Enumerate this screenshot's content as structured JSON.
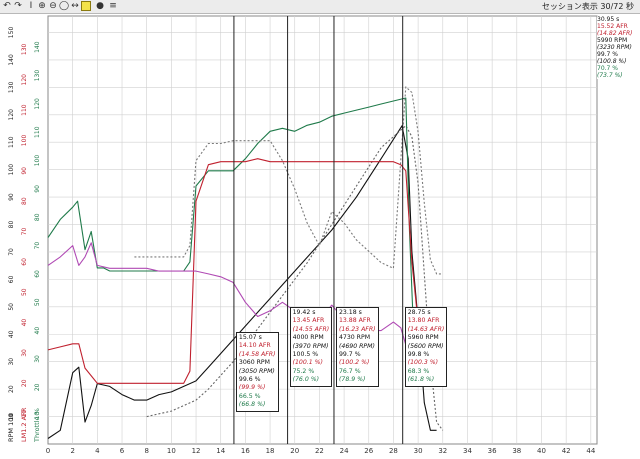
{
  "toolbar": {
    "title": "セッション表示  30/72 秒",
    "icons": [
      "undo-icon",
      "redo-icon",
      "cursor-icon",
      "zoom-in-icon",
      "zoom-out-icon",
      "zoom-fit-icon",
      "pan-icon",
      "highlight-icon",
      "record-icon",
      "menu-icon"
    ]
  },
  "info_panel": {
    "time": "30.95 s",
    "afr": "15.52 AFR",
    "afr_avg": "(14.82 AFR)",
    "rpm": "5990 RPM",
    "rpm_avg": "(3230 RPM)",
    "throttle": "99.7 %",
    "throttle_avg": "(100.8 %)",
    "throttle2": "70.7 %",
    "throttle2_avg": "(73.7 %)"
  },
  "chart_data": {
    "type": "line",
    "x_ticks": [
      "0",
      "2",
      "4",
      "6",
      "8",
      "10",
      "12",
      "14",
      "16",
      "18",
      "20",
      "22",
      "24",
      "26",
      "28",
      "30",
      "32",
      "34",
      "36",
      "38",
      "40",
      "42",
      "44"
    ],
    "xlim": [
      0,
      44.5
    ],
    "axes": {
      "rpm": {
        "ticks": [
          "10",
          "20",
          "30",
          "40",
          "50",
          "60",
          "70",
          "80",
          "90",
          "100",
          "110",
          "120",
          "130",
          "140",
          "150"
        ],
        "range": [
          0,
          156
        ],
        "label": "RPM 100",
        "color": "#222222"
      },
      "afr": {
        "ticks": [
          "10",
          "20",
          "30",
          "40",
          "50",
          "60",
          "70",
          "80",
          "90",
          "100",
          "110",
          "120",
          "130"
        ],
        "range": [
          0,
          141
        ],
        "label": "LM1.2 AFR",
        "color": "#c0202e"
      },
      "throttle": {
        "ticks": [
          "10",
          "20",
          "30",
          "40",
          "50",
          "60",
          "70",
          "80",
          "90",
          "100",
          "110",
          "120",
          "130",
          "140"
        ],
        "range": [
          0,
          151
        ],
        "label": "Throttle %",
        "color": "#1f7a4a"
      }
    },
    "cursors": [
      {
        "x": 15.07,
        "label": "15.07 s",
        "afr": "14.10 AFR",
        "afr_avg": "(14.58 AFR)",
        "rpm": "3060 RPM",
        "rpm_avg": "(3050 RPM)",
        "thr": "99.6 %",
        "thr_avg": "(99.9 %)",
        "thr2": "66.5 %",
        "thr2_avg": "(66.8 %)"
      },
      {
        "x": 19.42,
        "label": "19.42 s",
        "afr": "13.45 AFR",
        "afr_avg": "(14.55 AFR)",
        "rpm": "4000 RPM",
        "rpm_avg": "(3970 RPM)",
        "thr": "100.5 %",
        "thr_avg": "(100.1 %)",
        "thr2": "75.2 %",
        "thr2_avg": "(76.0 %)"
      },
      {
        "x": 23.18,
        "label": "23.18 s",
        "afr": "13.88 AFR",
        "afr_avg": "(16.23 AFR)",
        "rpm": "4730 RPM",
        "rpm_avg": "(4690 RPM)",
        "thr": "99.7 %",
        "thr_avg": "(100.2 %)",
        "thr2": "76.7 %",
        "thr2_avg": "(78.9 %)"
      },
      {
        "x": 28.75,
        "label": "28.75 s",
        "afr": "13.80 AFR",
        "afr_avg": "(14.63 AFR)",
        "rpm": "5960 RPM",
        "rpm_avg": "(5600 RPM)",
        "thr": "99.8 %",
        "thr_avg": "(100.3 %)",
        "thr2": "68.3 %",
        "thr2_avg": "(61.8 %)"
      }
    ],
    "series": [
      {
        "axis": "rpm",
        "color": "#111111",
        "dash": false,
        "points": [
          [
            0,
            2
          ],
          [
            1,
            5
          ],
          [
            2,
            26
          ],
          [
            2.5,
            28
          ],
          [
            3,
            8
          ],
          [
            3.5,
            14
          ],
          [
            4,
            22
          ],
          [
            5,
            21
          ],
          [
            6,
            18
          ],
          [
            7,
            16
          ],
          [
            8,
            16
          ],
          [
            9,
            18
          ],
          [
            10,
            19
          ],
          [
            11,
            21
          ],
          [
            12,
            23
          ],
          [
            13,
            28
          ],
          [
            15,
            38
          ],
          [
            17,
            48
          ],
          [
            19,
            58
          ],
          [
            21,
            68
          ],
          [
            23,
            78
          ],
          [
            25,
            90
          ],
          [
            27,
            104
          ],
          [
            28.7,
            116
          ],
          [
            29.2,
            104
          ],
          [
            29.5,
            70
          ],
          [
            30,
            45
          ],
          [
            30.5,
            15
          ],
          [
            31,
            5
          ],
          [
            31.5,
            5
          ]
        ]
      },
      {
        "axis": "rpm",
        "color": "#666666",
        "dash": true,
        "points": [
          [
            8,
            10
          ],
          [
            9,
            11
          ],
          [
            10,
            12
          ],
          [
            11,
            14
          ],
          [
            12,
            16
          ],
          [
            13,
            20
          ],
          [
            15,
            30
          ],
          [
            17,
            42
          ],
          [
            19,
            54
          ],
          [
            21,
            66
          ],
          [
            23,
            80
          ],
          [
            25,
            94
          ],
          [
            27,
            108
          ],
          [
            29,
            116
          ],
          [
            29.5,
            112
          ],
          [
            30,
            95
          ],
          [
            30.5,
            62
          ],
          [
            31,
            30
          ],
          [
            31.5,
            8
          ],
          [
            32,
            5
          ]
        ]
      },
      {
        "axis": "afr",
        "color": "#1f7a4a",
        "dash": false,
        "points": [
          [
            0,
            68
          ],
          [
            1,
            74
          ],
          [
            2,
            78
          ],
          [
            2.4,
            80
          ],
          [
            3,
            64
          ],
          [
            3.5,
            70
          ],
          [
            4,
            58
          ],
          [
            4.5,
            58
          ],
          [
            5,
            57
          ],
          [
            6,
            57
          ],
          [
            7,
            57
          ],
          [
            8,
            57
          ],
          [
            9,
            57
          ],
          [
            10,
            57
          ],
          [
            11,
            57
          ],
          [
            11.5,
            60
          ],
          [
            12,
            85
          ],
          [
            13,
            90
          ],
          [
            14,
            90
          ],
          [
            15,
            90
          ],
          [
            16,
            94
          ],
          [
            17,
            99
          ],
          [
            18,
            103
          ],
          [
            19,
            104
          ],
          [
            20,
            103
          ],
          [
            21,
            105
          ],
          [
            22,
            106
          ],
          [
            23,
            108
          ],
          [
            24,
            109
          ],
          [
            25,
            110
          ],
          [
            26,
            111
          ],
          [
            27,
            112
          ],
          [
            28,
            113
          ],
          [
            29,
            114
          ],
          [
            29.3,
            70
          ],
          [
            29.6,
            40
          ],
          [
            30,
            28
          ],
          [
            30.5,
            25
          ],
          [
            31,
            26
          ]
        ]
      },
      {
        "axis": "afr",
        "color": "#c0202e",
        "dash": false,
        "points": [
          [
            0,
            31
          ],
          [
            1,
            32
          ],
          [
            2,
            33
          ],
          [
            2.5,
            33
          ],
          [
            3,
            25
          ],
          [
            4,
            20
          ],
          [
            5,
            20
          ],
          [
            6,
            20
          ],
          [
            7,
            20
          ],
          [
            8,
            20
          ],
          [
            9,
            20
          ],
          [
            10,
            20
          ],
          [
            11,
            20
          ],
          [
            11.5,
            24
          ],
          [
            12,
            80
          ],
          [
            13,
            92
          ],
          [
            14,
            93
          ],
          [
            15,
            93
          ],
          [
            16,
            93
          ],
          [
            17,
            94
          ],
          [
            18,
            93
          ],
          [
            19,
            93
          ],
          [
            20,
            93
          ],
          [
            21,
            93
          ],
          [
            22,
            93
          ],
          [
            23,
            93
          ],
          [
            24,
            93
          ],
          [
            25,
            93
          ],
          [
            26,
            93
          ],
          [
            27,
            93
          ],
          [
            28,
            93
          ],
          [
            28.6,
            92
          ],
          [
            29,
            90
          ],
          [
            29.5,
            60
          ],
          [
            30,
            40
          ],
          [
            30.5,
            35
          ],
          [
            31,
            32
          ]
        ]
      },
      {
        "axis": "throttle",
        "color": "#b04ab4",
        "dash": false,
        "points": [
          [
            0,
            63
          ],
          [
            1,
            66
          ],
          [
            2,
            70
          ],
          [
            2.5,
            63
          ],
          [
            3,
            66
          ],
          [
            3.5,
            71
          ],
          [
            4,
            63
          ],
          [
            5,
            62
          ],
          [
            6,
            62
          ],
          [
            7,
            62
          ],
          [
            8,
            62
          ],
          [
            9,
            61
          ],
          [
            10,
            61
          ],
          [
            11,
            61
          ],
          [
            12,
            61
          ],
          [
            13,
            60
          ],
          [
            14,
            59
          ],
          [
            15,
            57
          ],
          [
            16,
            50
          ],
          [
            17,
            45
          ],
          [
            18,
            47
          ],
          [
            19,
            50
          ],
          [
            20,
            47
          ],
          [
            21,
            44
          ],
          [
            22,
            44
          ],
          [
            23,
            49
          ],
          [
            24,
            44
          ],
          [
            25,
            41
          ],
          [
            26,
            40
          ],
          [
            27,
            40
          ],
          [
            28,
            43
          ],
          [
            28.6,
            41
          ],
          [
            29,
            35
          ],
          [
            29.5,
            30
          ],
          [
            30,
            25
          ],
          [
            30.5,
            22
          ],
          [
            31,
            22
          ]
        ]
      },
      {
        "axis": "throttle",
        "color": "#7a7a7a",
        "dash": true,
        "points": [
          [
            7,
            66
          ],
          [
            8,
            66
          ],
          [
            9,
            66
          ],
          [
            10,
            66
          ],
          [
            11,
            66
          ],
          [
            11.5,
            70
          ],
          [
            12,
            100
          ],
          [
            13,
            106
          ],
          [
            14,
            106
          ],
          [
            15,
            107
          ],
          [
            16,
            107
          ],
          [
            17,
            107
          ],
          [
            18,
            107
          ],
          [
            19,
            100
          ],
          [
            20,
            90
          ],
          [
            21,
            78
          ],
          [
            22,
            70
          ],
          [
            23,
            82
          ],
          [
            24,
            78
          ],
          [
            25,
            72
          ],
          [
            26,
            68
          ],
          [
            27,
            64
          ],
          [
            28,
            62
          ],
          [
            29,
            126
          ],
          [
            29.5,
            124
          ],
          [
            30,
            110
          ],
          [
            30.5,
            85
          ],
          [
            31,
            65
          ],
          [
            31.5,
            60
          ],
          [
            32,
            60
          ]
        ]
      }
    ]
  }
}
